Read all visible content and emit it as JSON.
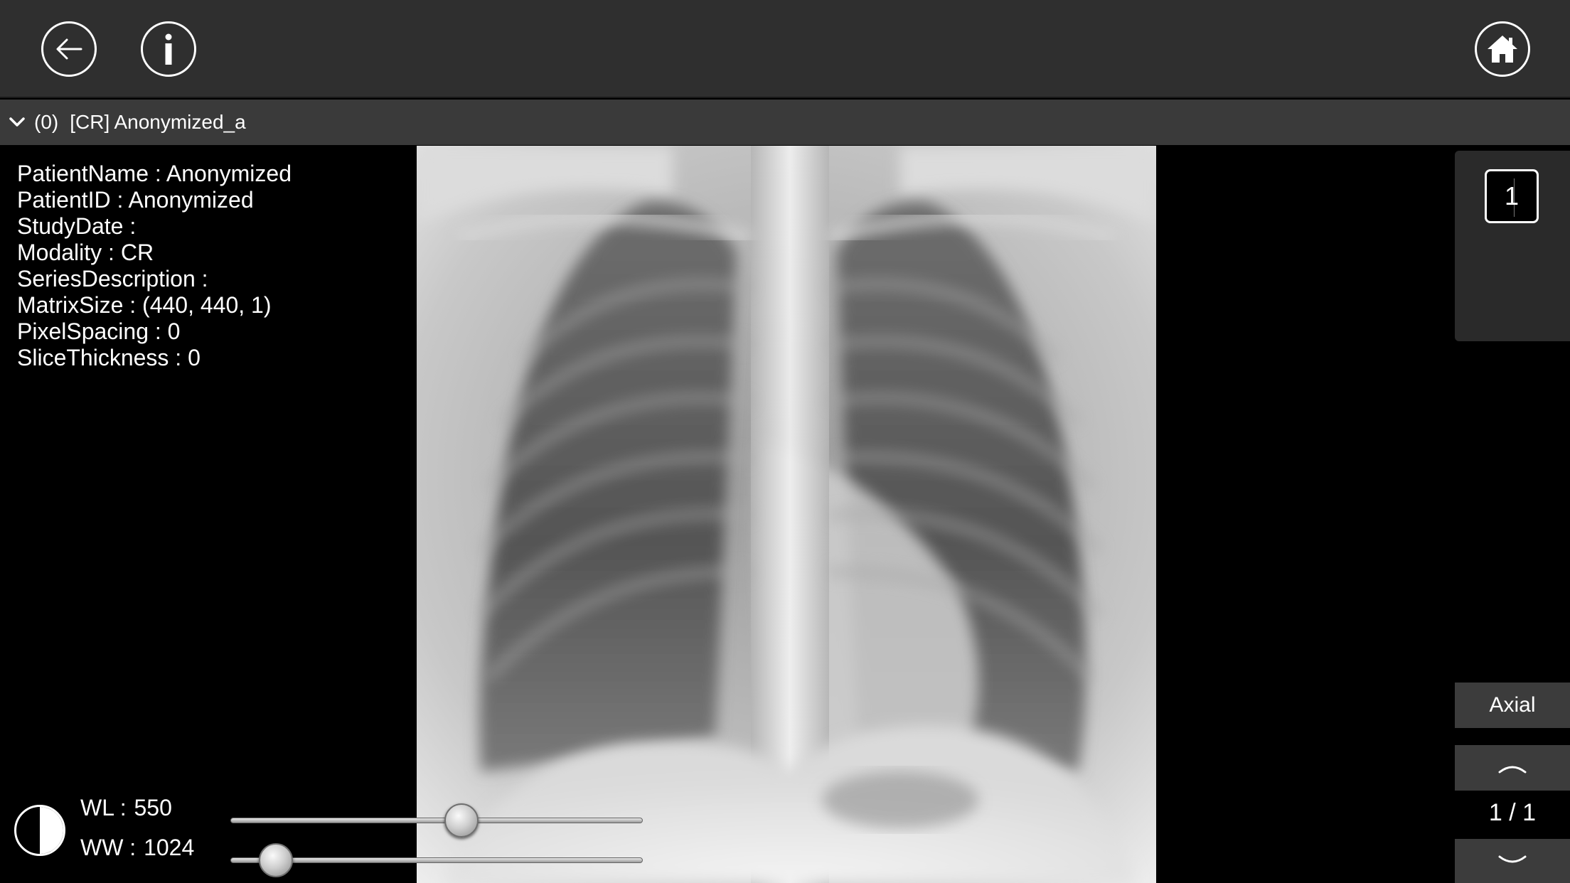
{
  "toolbar": {
    "back_icon": "back-arrow-icon",
    "info_icon": "info-icon",
    "home_icon": "home-icon"
  },
  "series": {
    "index": "(0)",
    "name": "[CR] Anonymized_a"
  },
  "patient_info": [
    "PatientName : Anonymized",
    "PatientID : Anonymized",
    "StudyDate :",
    "Modality : CR",
    "SeriesDescription :",
    "MatrixSize : (440, 440, 1)",
    "PixelSpacing : 0",
    "SliceThickness : 0"
  ],
  "controls": {
    "wl_label": "WL :",
    "wl_value": "550",
    "ww_label": "WW :",
    "ww_value": "1024",
    "wl_slider_fraction": 0.56,
    "ww_slider_fraction": 0.11
  },
  "side": {
    "thumbnail_label": "1",
    "view_mode": "Axial",
    "slice_counter": "1 / 1"
  }
}
